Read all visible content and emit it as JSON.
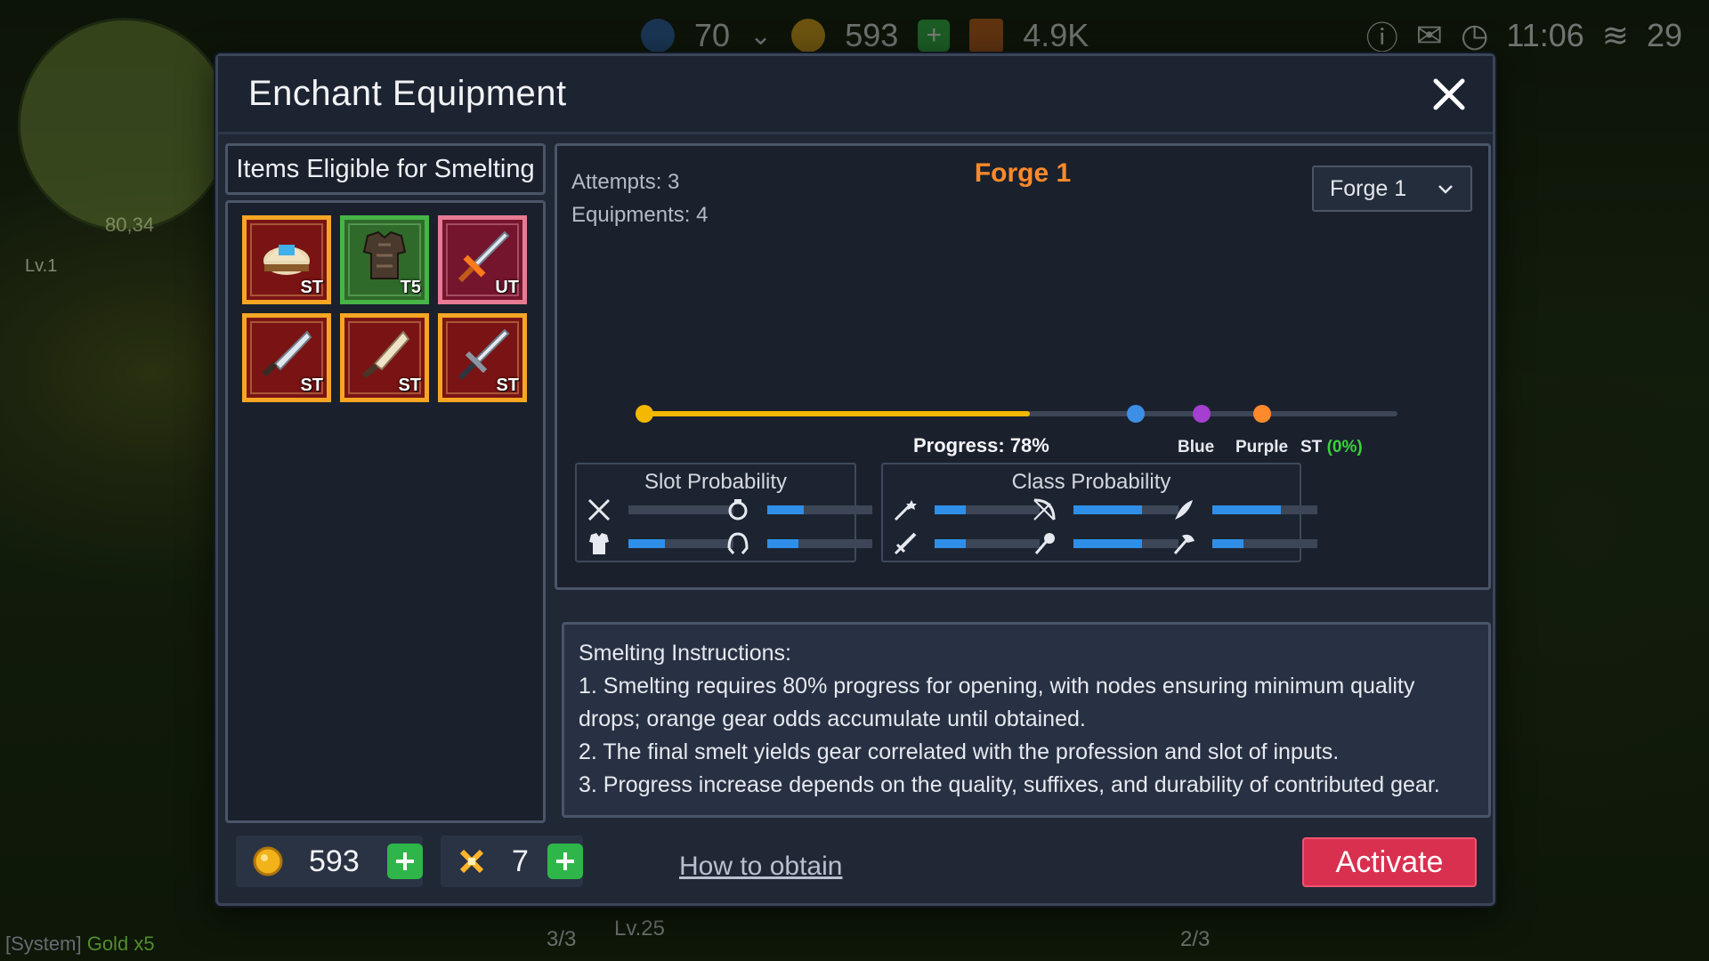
{
  "hud": {
    "level_value": "70",
    "gold_value": "593",
    "gems_value": "4.9K",
    "clock": "11:06",
    "signal": "29",
    "minimap_coords": "80,34",
    "player_level": "Lv.1",
    "bottom_level": "Lv.25",
    "counter_left": "3/3",
    "counter_right": "2/3",
    "sys_prefix": "[System]",
    "sys_item": "Gold",
    "sys_qty": "x5"
  },
  "dialog": {
    "title": "Enchant Equipment"
  },
  "left": {
    "header": "Items Eligible for Smelting",
    "items": [
      {
        "tag": "ST",
        "icon": "helmet-icon",
        "rarity": "orange"
      },
      {
        "tag": "T5",
        "icon": "chest-armor-icon",
        "rarity": "green"
      },
      {
        "tag": "UT",
        "icon": "sword-icon",
        "rarity": "pink"
      },
      {
        "tag": "ST",
        "icon": "blade-icon",
        "rarity": "orange"
      },
      {
        "tag": "ST",
        "icon": "dagger-icon",
        "rarity": "orange"
      },
      {
        "tag": "ST",
        "icon": "longsword-icon",
        "rarity": "orange"
      }
    ]
  },
  "forge": {
    "attempts": "Attempts: 3",
    "equipments": "Equipments: 4",
    "title": "Forge 1",
    "selected": "Forge 1",
    "progress_label": "Progress: 78%",
    "progress_value": 0.78,
    "nodes": {
      "blue": "Blue",
      "purple": "Purple",
      "st": "ST",
      "st_pct": "(0%)"
    },
    "slot_probability": {
      "title": "Slot Probability",
      "rows": [
        {
          "icon": "crossed-swords-icon",
          "value": 0
        },
        {
          "icon": "ring-icon",
          "value": 0.35
        },
        {
          "icon": "armor-icon",
          "value": 0.35
        },
        {
          "icon": "helmet-slot-icon",
          "value": 0.3
        }
      ]
    },
    "class_probability": {
      "title": "Class Probability",
      "rows": [
        {
          "icon": "wand-icon",
          "value": 0.3
        },
        {
          "icon": "bow-icon",
          "value": 0.65
        },
        {
          "icon": "quill-icon",
          "value": 0.65
        },
        {
          "icon": "short-sword-icon",
          "value": 0.3
        },
        {
          "icon": "staff-icon",
          "value": 0.65
        },
        {
          "icon": "axe-icon",
          "value": 0.3
        }
      ]
    }
  },
  "instructions": {
    "heading": "Smelting Instructions:",
    "line1": "1. Smelting requires 80% progress for opening, with nodes ensuring minimum quality drops; orange gear odds accumulate until obtained.",
    "line2": "2. The final smelt yields gear correlated with the profession and slot of inputs.",
    "line3": "3. Progress increase depends on the quality, suffixes, and durability of contributed gear."
  },
  "footer": {
    "gold": "593",
    "material": "7",
    "how_to_obtain": "How to obtain",
    "activate": "Activate"
  },
  "colors": {
    "accent_orange": "#ff8a2b",
    "progress_yellow": "#f5b800",
    "node_blue": "#3d8fe6",
    "node_purple": "#a53fd0",
    "activate_red": "#d9304f",
    "plus_green": "#2fb64a"
  }
}
